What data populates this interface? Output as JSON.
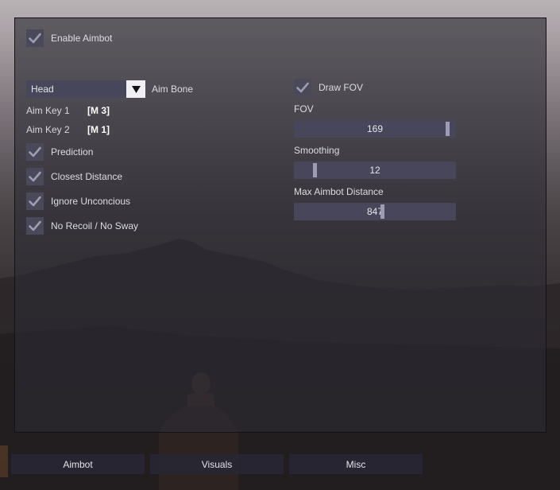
{
  "aimbot": {
    "enable_label": "Enable Aimbot",
    "enable_checked": true,
    "aim_bone": {
      "selected": "Head",
      "label": "Aim Bone"
    },
    "aim_key_1": {
      "label": "Aim Key 1",
      "value": "[M 3]"
    },
    "aim_key_2": {
      "label": "Aim Key 2",
      "value": "[M 1]"
    },
    "options": [
      {
        "label": "Prediction",
        "checked": true
      },
      {
        "label": "Closest Distance",
        "checked": true
      },
      {
        "label": "Ignore Unconcious",
        "checked": true
      },
      {
        "label": "No Recoil / No Sway",
        "checked": true
      }
    ],
    "draw_fov": {
      "label": "Draw FOV",
      "checked": true
    },
    "sliders": [
      {
        "label": "FOV",
        "value": "169",
        "fraction": 0.96
      },
      {
        "label": "Smoothing",
        "value": "12",
        "fraction": 0.12
      },
      {
        "label": "Max Aimbot Distance",
        "value": "847",
        "fraction": 0.55
      }
    ]
  },
  "tabs": [
    {
      "label": "Aimbot"
    },
    {
      "label": "Visuals"
    },
    {
      "label": "Misc"
    }
  ],
  "colors": {
    "panel_bg": "#2c2b34",
    "control_bg": "#47465a",
    "checkbox_bg": "#4a495a",
    "check_mark": "#9e9db2",
    "slider_handle": "#9d9cb2"
  }
}
